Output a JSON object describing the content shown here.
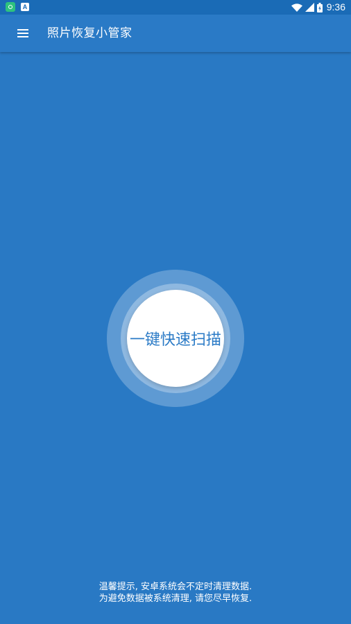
{
  "status_bar": {
    "time": "9:36",
    "icons": [
      "app-notification-icon",
      "text-notification-icon",
      "wifi-icon",
      "cellular-signal-icon",
      "battery-icon"
    ]
  },
  "toolbar": {
    "menu_icon": "menu-icon",
    "title": "照片恢复小管家"
  },
  "scan": {
    "button_label": "一键快速扫描"
  },
  "tip": {
    "line1": "温馨提示, 安卓系统会不定时清理数据.",
    "line2": "为避免数据被系统清理, 请您尽早恢复."
  },
  "colors": {
    "background": "#2979c4",
    "status_bar": "#1a6bb6",
    "toolbar": "#2a7ac6",
    "button_text": "#2a7ac6"
  }
}
